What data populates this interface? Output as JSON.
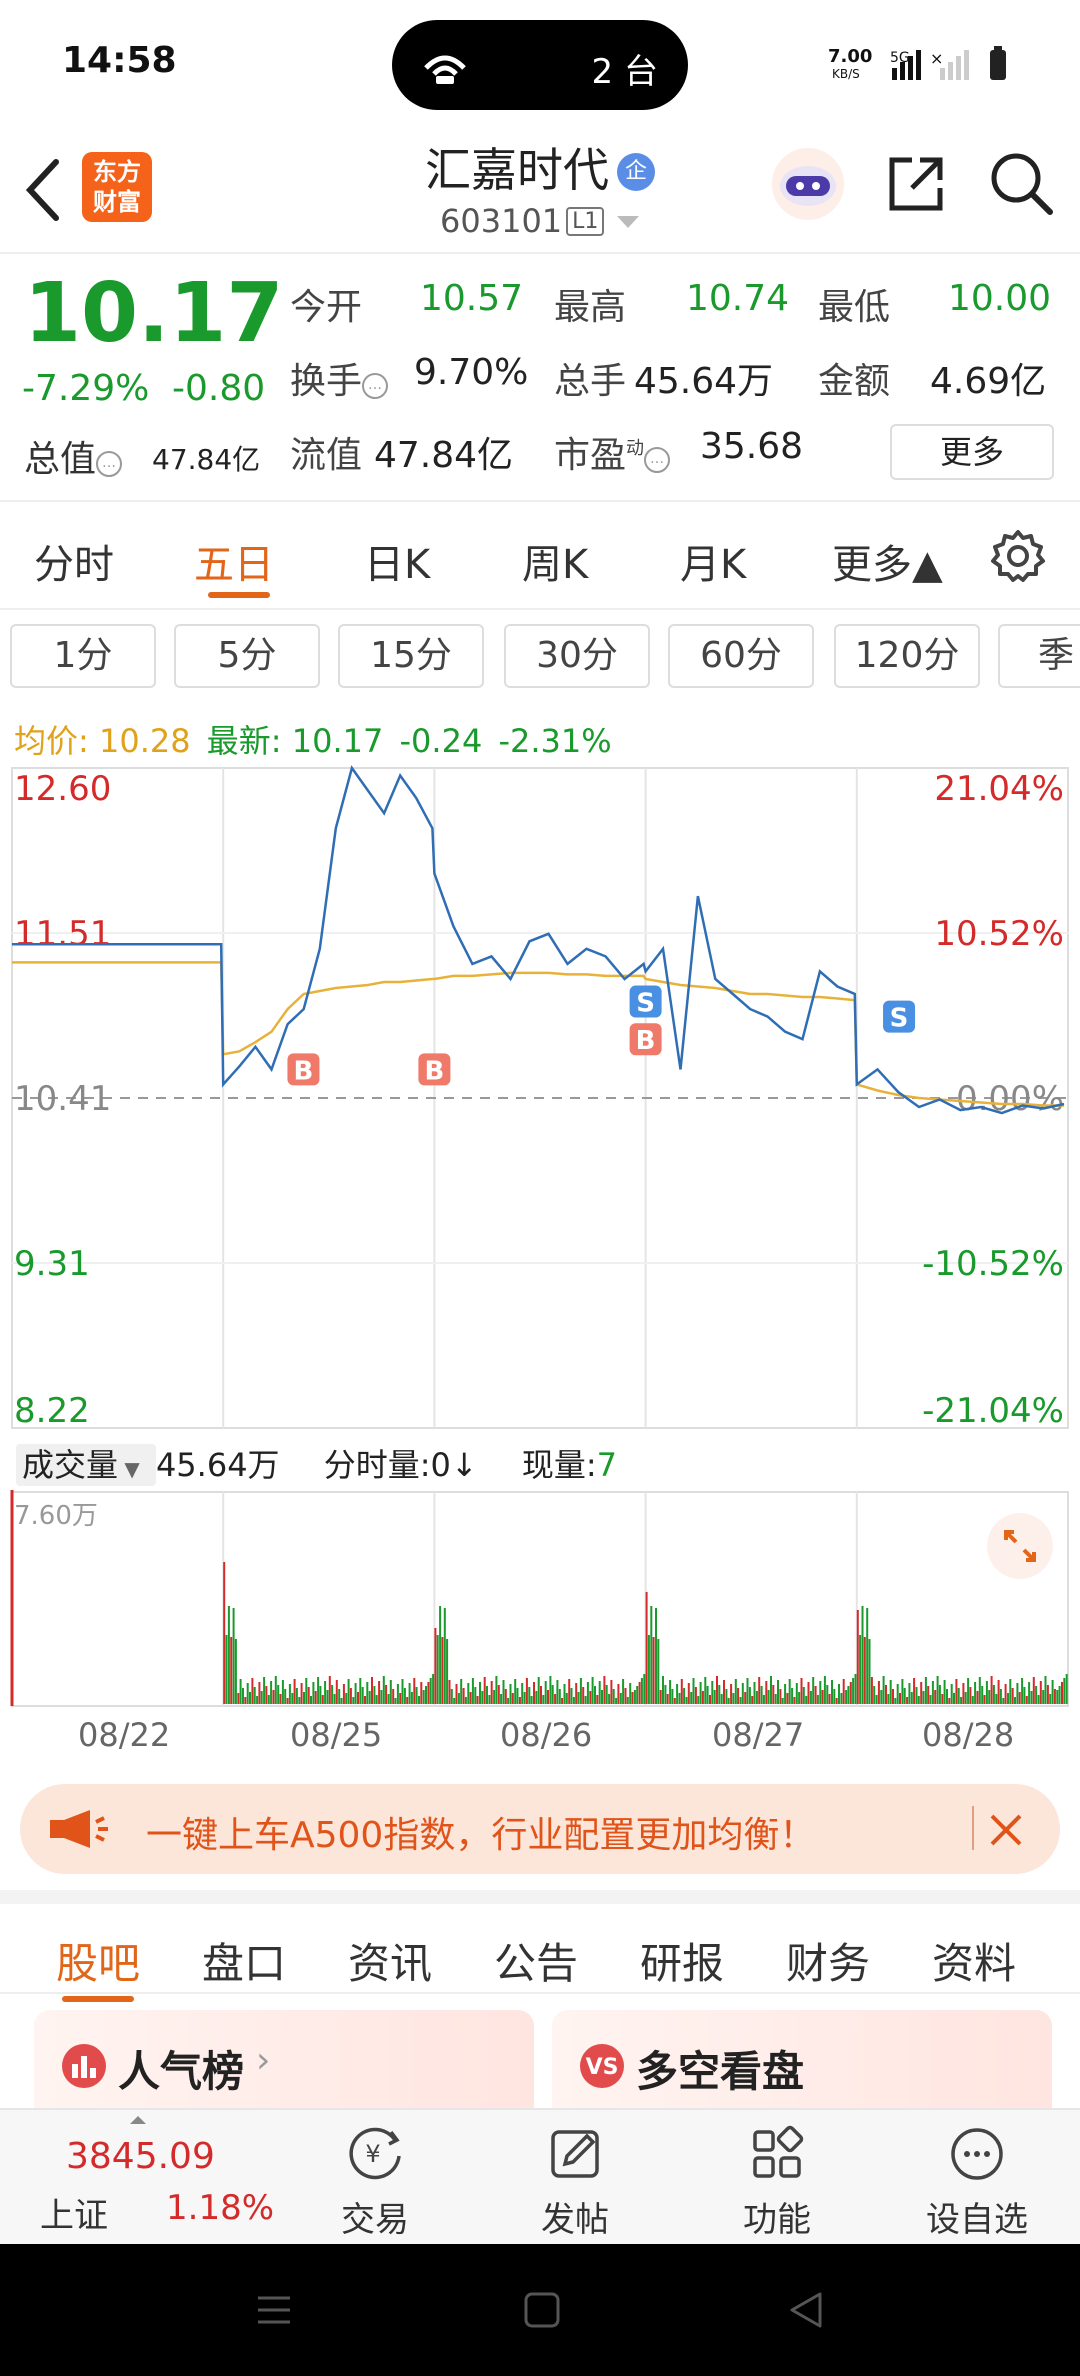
{
  "status_bar": {
    "time": "14:58",
    "island_count": "2 台",
    "net_speed": "7.00",
    "net_unit": "KB/S",
    "signal": "5G"
  },
  "header": {
    "stock_name": "汇嘉时代",
    "cert_badge": "企",
    "stock_code": "603101",
    "level_tag": "L1",
    "logo_text": "东方财富"
  },
  "quote": {
    "price": "10.17",
    "change_pct": "-7.29%",
    "change": "-0.80",
    "total_cap_label": "总值",
    "total_cap_value": "47.84亿",
    "open_label": "今开",
    "open_value": "10.57",
    "high_label": "最高",
    "high_value": "10.74",
    "low_label": "最低",
    "low_value": "10.00",
    "turnover_label": "换手",
    "turnover_value": "9.70%",
    "volume_label": "总手",
    "volume_value": "45.64万",
    "amount_label": "金额",
    "amount_value": "4.69亿",
    "float_cap_label": "流值",
    "float_cap_value": "47.84亿",
    "pe_label": "市盈",
    "pe_sup": "动",
    "pe_value": "35.68",
    "more_button": "更多"
  },
  "period_tabs": [
    "分时",
    "五日",
    "日K",
    "周K",
    "月K",
    "更多▲"
  ],
  "minute_buttons": [
    "1分",
    "5分",
    "15分",
    "30分",
    "60分",
    "120分",
    "季"
  ],
  "info_line": {
    "avg_label": "均价:",
    "avg_value": "10.28",
    "latest_label": "最新:",
    "latest_value": "10.17",
    "latest_change": "-0.24",
    "latest_pct": "-2.31%"
  },
  "chart_data": {
    "type": "line",
    "title": "",
    "y_left_ticks": [
      "12.60",
      "11.51",
      "10.41",
      "9.31",
      "8.22"
    ],
    "y_right_ticks": [
      "21.04%",
      "10.52%",
      "0.00%",
      "-10.52%",
      "-21.04%"
    ],
    "ylim": [
      8.22,
      12.6
    ],
    "x_days": [
      "08/22",
      "08/25",
      "08/26",
      "08/27",
      "08/28"
    ],
    "series": [
      {
        "name": "price",
        "color": "#2f6db5",
        "values": [
          11.43,
          11.43,
          11.43,
          11.43,
          11.43,
          11.43,
          11.43,
          11.43,
          10.5,
          10.62,
          10.75,
          10.6,
          10.9,
          11.0,
          11.4,
          12.2,
          12.6,
          12.45,
          12.3,
          12.55,
          12.4,
          12.2,
          11.9,
          11.55,
          11.3,
          11.35,
          11.2,
          11.45,
          11.5,
          11.3,
          11.4,
          11.35,
          11.2,
          11.3,
          11.25,
          11.4,
          10.6,
          11.75,
          11.2,
          11.1,
          11.0,
          10.95,
          10.85,
          10.8,
          11.25,
          11.15,
          11.1,
          10.5,
          10.6,
          10.45,
          10.35,
          10.4,
          10.33,
          10.35,
          10.31,
          10.36,
          10.34,
          10.37
        ]
      },
      {
        "name": "avg",
        "color": "#e8b23a",
        "values": [
          11.31,
          11.31,
          11.31,
          11.31,
          11.31,
          11.31,
          11.31,
          11.31,
          10.7,
          10.72,
          10.78,
          10.85,
          11.0,
          11.1,
          11.12,
          11.14,
          11.15,
          11.16,
          11.18,
          11.18,
          11.19,
          11.2,
          11.2,
          11.22,
          11.22,
          11.23,
          11.24,
          11.24,
          11.24,
          11.23,
          11.23,
          11.22,
          11.22,
          11.22,
          11.2,
          11.18,
          11.16,
          11.15,
          11.14,
          11.12,
          11.1,
          11.1,
          11.09,
          11.08,
          11.08,
          11.07,
          11.06,
          10.5,
          10.46,
          10.43,
          10.41,
          10.4,
          10.39,
          10.38,
          10.37,
          10.37,
          10.36,
          10.36
        ]
      }
    ],
    "markers": [
      {
        "label": "B",
        "day_pos": 1.38,
        "price": 10.6
      },
      {
        "label": "B",
        "day_pos": 2.0,
        "price": 10.6
      },
      {
        "label": "S",
        "day_pos": 3.0,
        "price": 11.05
      },
      {
        "label": "B",
        "day_pos": 3.0,
        "price": 10.8
      },
      {
        "label": "S",
        "day_pos": 4.2,
        "price": 10.95
      }
    ],
    "volume": {
      "label": "成交量",
      "total": "45.64万",
      "minute_label": "分时量:0↓",
      "current_label": "现量:",
      "current_value": "7",
      "max_tick": "7.60万"
    }
  },
  "banner": {
    "text": "一键上车A500指数，行业配置更加均衡！"
  },
  "bottom_tabs": [
    "股吧",
    "盘口",
    "资讯",
    "公告",
    "研报",
    "财务",
    "资料"
  ],
  "cards": [
    {
      "title": "人气榜"
    },
    {
      "title": "多空看盘"
    }
  ],
  "bottom_bar": {
    "index_value": "3845.09",
    "index_name": "上证",
    "index_pct": "1.18%",
    "items": [
      "交易",
      "发帖",
      "功能",
      "设自选"
    ]
  }
}
